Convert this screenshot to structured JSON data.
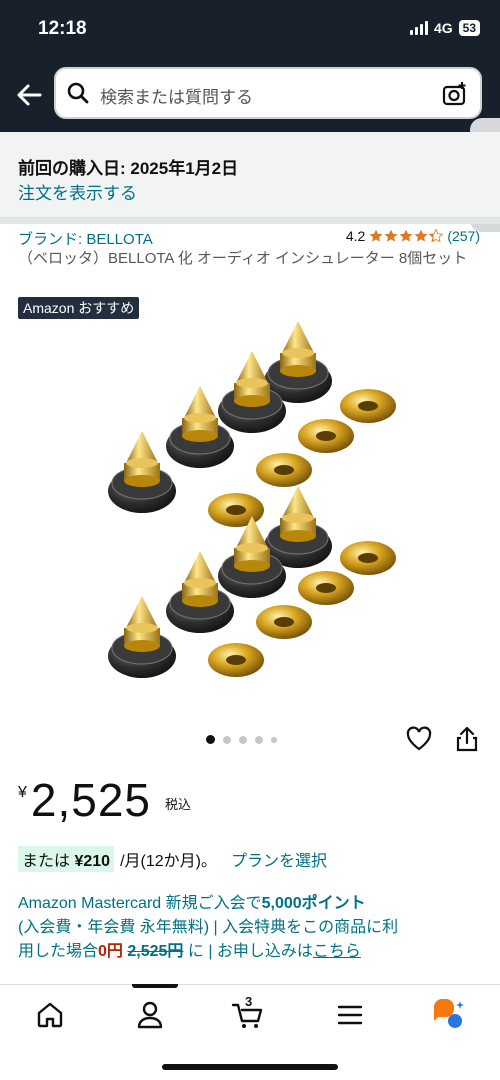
{
  "status_bar": {
    "time": "12:18",
    "network": "4G",
    "battery": "53"
  },
  "header": {
    "search_placeholder": "検索または質問する",
    "icons": [
      "back-arrow-icon",
      "search-icon",
      "camera-icon",
      "chevron-left-icon"
    ]
  },
  "purchase": {
    "title": "前回の購入日: 2025年1月2日",
    "link": "注文を表示する"
  },
  "product": {
    "brand": "ブランド: BELLOTA",
    "rating": "4.2",
    "rating_stars": 4.2,
    "review_count": "(257)",
    "title": "（ベロッタ）BELLOTA 化 オーディオ インシュレーター 8個セット",
    "badge": "Amazon おすすめ",
    "image_count": 5,
    "image_index": 1
  },
  "price": {
    "currency": "¥",
    "amount": "2,525",
    "tax": "税込"
  },
  "installment": {
    "prefix": "または",
    "amount": "¥210",
    "period": "/月(12か月)。",
    "link": "プランを選択"
  },
  "card_promo": {
    "line1_a": "Amazon Mastercard 新規ご入会で",
    "line1_b": "5,000ポイント",
    "line2": "(入会費・年会費 永年無料) | 入会特典をこの商品に利",
    "line3_a": "用した場合",
    "line3_price": "0円",
    "line3_strike": "2,525円",
    "line3_b": " に | お申し込みは",
    "line3_link": "こちら"
  },
  "bottom_nav": {
    "cart_count": "3",
    "items": [
      "home-icon",
      "account-icon",
      "cart-icon",
      "menu-icon",
      "rufus-icon"
    ]
  },
  "colors": {
    "header_bg": "#18202b",
    "link": "#007185",
    "price_red": "#b12704",
    "star": "#de7921"
  }
}
